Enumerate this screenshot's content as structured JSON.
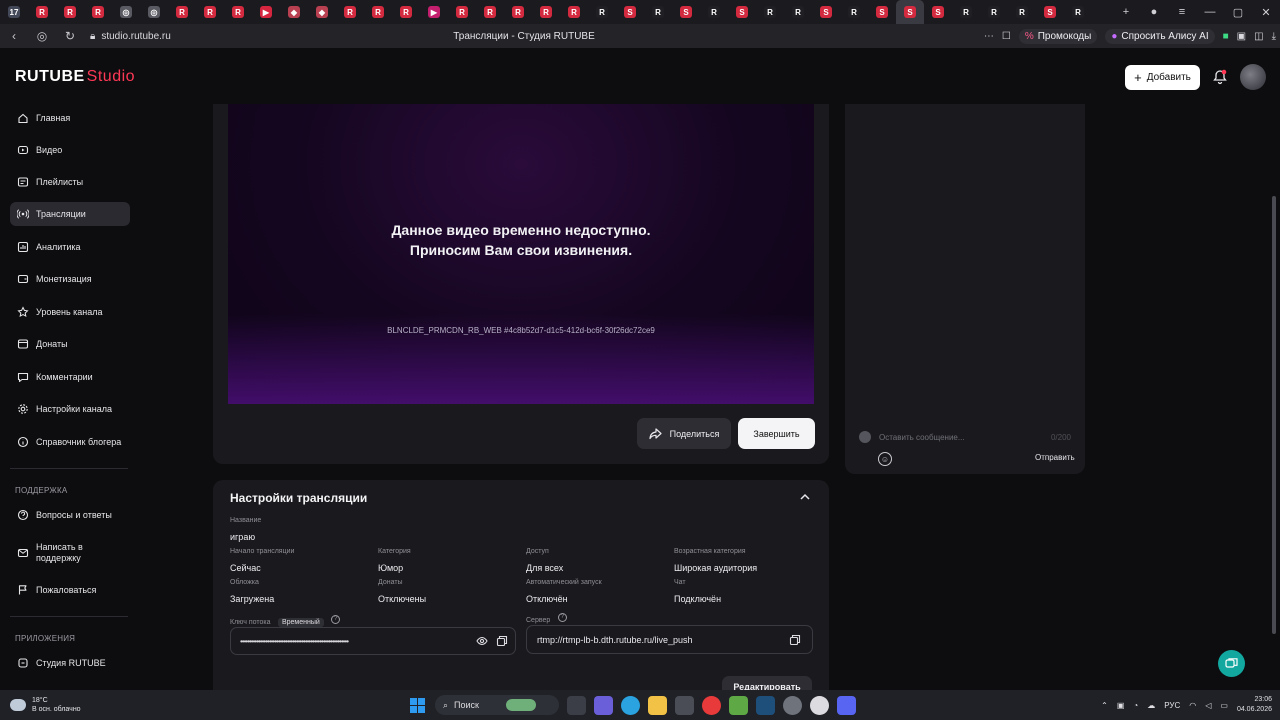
{
  "browser": {
    "tab_icons": [
      {
        "name": "vk-tab",
        "glyph": "17",
        "color": "#44495a"
      },
      {
        "name": "rutube-tab-1",
        "glyph": "R",
        "color": "#d32a3f"
      },
      {
        "name": "rutube-tab-2",
        "glyph": "R",
        "color": "#d32a3f"
      },
      {
        "name": "rutube-tab-3",
        "glyph": "R",
        "color": "#d32a3f"
      },
      {
        "name": "globe-tab",
        "glyph": "◎",
        "color": "#5a5a63"
      },
      {
        "name": "globe-tab-2",
        "glyph": "◎",
        "color": "#5a5a63"
      },
      {
        "name": "rutube-tab-4",
        "glyph": "R",
        "color": "#d32a3f"
      },
      {
        "name": "rutube-tab-5",
        "glyph": "R",
        "color": "#d32a3f"
      },
      {
        "name": "rutube-tab-6",
        "glyph": "R",
        "color": "#d32a3f"
      },
      {
        "name": "play-tab",
        "glyph": "▶",
        "color": "#d6263f"
      },
      {
        "name": "game-tab-1",
        "glyph": "◆",
        "color": "#b84050"
      },
      {
        "name": "game-tab-2",
        "glyph": "◆",
        "color": "#b84050"
      },
      {
        "name": "rutube-tab-7",
        "glyph": "R",
        "color": "#d32a3f"
      },
      {
        "name": "rutube-tab-8",
        "glyph": "R",
        "color": "#d32a3f"
      },
      {
        "name": "rutube-tab-9",
        "glyph": "R",
        "color": "#d32a3f"
      },
      {
        "name": "video-tab",
        "glyph": "▶",
        "color": "#c41e6e"
      },
      {
        "name": "rutube-tab-10",
        "glyph": "R",
        "color": "#d32a3f"
      },
      {
        "name": "rutube-tab-11",
        "glyph": "R",
        "color": "#d32a3f"
      },
      {
        "name": "rutube-tab-12",
        "glyph": "R",
        "color": "#d32a3f"
      },
      {
        "name": "rutube-tab-13",
        "glyph": "R",
        "color": "#d32a3f"
      },
      {
        "name": "rutube-tab-14",
        "glyph": "R",
        "color": "#d32a3f"
      },
      {
        "name": "rutube-tab-15",
        "glyph": "R",
        "color": "#1f1f24"
      },
      {
        "name": "studio-tab-1",
        "glyph": "S",
        "color": "#d32a3f"
      },
      {
        "name": "rutube-tab-16",
        "glyph": "R",
        "color": "#1f1f24"
      },
      {
        "name": "studio-tab-2",
        "glyph": "S",
        "color": "#d32a3f"
      },
      {
        "name": "rutube-tab-17",
        "glyph": "R",
        "color": "#1f1f24"
      },
      {
        "name": "studio-tab-3",
        "glyph": "S",
        "color": "#d32a3f"
      },
      {
        "name": "rutube-tab-18",
        "glyph": "R",
        "color": "#1f1f24"
      },
      {
        "name": "rutube-tab-19",
        "glyph": "R",
        "color": "#1f1f24"
      },
      {
        "name": "studio-tab-4",
        "glyph": "S",
        "color": "#d32a3f"
      },
      {
        "name": "rutube-tab-20",
        "glyph": "R",
        "color": "#1f1f24"
      },
      {
        "name": "studio-tab-5",
        "glyph": "S",
        "color": "#d32a3f"
      },
      {
        "name": "studio-tab-active",
        "glyph": "S",
        "color": "#d32a3f",
        "active": true
      },
      {
        "name": "studio-tab-6",
        "glyph": "S",
        "color": "#d32a3f"
      },
      {
        "name": "rutube-tab-21",
        "glyph": "R",
        "color": "#1f1f24"
      },
      {
        "name": "rutube-tab-22",
        "glyph": "R",
        "color": "#1f1f24"
      },
      {
        "name": "rutube-tab-23",
        "glyph": "R",
        "color": "#1f1f24"
      },
      {
        "name": "studio-tab-7",
        "glyph": "S",
        "color": "#d32a3f"
      },
      {
        "name": "rutube-tab-24",
        "glyph": "R",
        "color": "#1f1f24"
      }
    ],
    "url": "studio.rutube.ru",
    "page_title": "Трансляции - Студия RUTUBE",
    "promo_label": "Промокоды",
    "alice_label": "Спросить Алису AI"
  },
  "header": {
    "logo_main": "RUTUBE",
    "logo_studio": "Studio",
    "add_label": "Добавить",
    "accent": "#ff3856"
  },
  "sidebar": {
    "items": [
      {
        "id": "home",
        "label": "Главная",
        "icon": "home-icon"
      },
      {
        "id": "video",
        "label": "Видео",
        "icon": "video-icon"
      },
      {
        "id": "playlists",
        "label": "Плейлисты",
        "icon": "playlist-icon"
      },
      {
        "id": "streams",
        "label": "Трансляции",
        "icon": "broadcast-icon",
        "active": true
      },
      {
        "id": "analytics",
        "label": "Аналитика",
        "icon": "analytics-icon"
      },
      {
        "id": "monetization",
        "label": "Монетизация",
        "icon": "wallet-icon"
      },
      {
        "id": "channel-level",
        "label": "Уровень канала",
        "icon": "star-icon"
      },
      {
        "id": "donations",
        "label": "Донаты",
        "icon": "donate-icon"
      },
      {
        "id": "comments",
        "label": "Комментарии",
        "icon": "comment-icon"
      },
      {
        "id": "channel-settings",
        "label": "Настройки канала",
        "icon": "gear-icon"
      },
      {
        "id": "blogger-guide",
        "label": "Справочник блогера",
        "icon": "info-icon"
      }
    ],
    "support_title": "ПОДДЕРЖКА",
    "support_items": [
      {
        "id": "faq",
        "label": "Вопросы и ответы",
        "icon": "question-icon"
      },
      {
        "id": "contact",
        "label": "Написать в поддержку",
        "label_line2": "",
        "icon": "mail-icon"
      },
      {
        "id": "complain",
        "label": "Пожаловаться",
        "icon": "flag-icon"
      }
    ],
    "apps_title": "ПРИЛОЖЕНИЯ",
    "apps_items": [
      {
        "id": "studio-app",
        "label": "Студия RUTUBE",
        "icon": "app-icon"
      }
    ]
  },
  "player": {
    "message_line1": "Данное видео временно недоступно.",
    "message_line2": "Приносим Вам свои извинения.",
    "error_code": "BLNCLDE_PRMCDN_RB_WEB #4c8b52d7-d1c5-412d-bc6f-30f26dc72ce9",
    "share_label": "Поделиться",
    "end_label": "Завершить"
  },
  "chat": {
    "placeholder": "Оставить сообщение...",
    "counter": "0/200",
    "send_label": "Отправить"
  },
  "settings": {
    "title": "Настройки трансляции",
    "name_label": "Название",
    "name_value": "играю",
    "start_label": "Начало трансляции",
    "start_value": "Сейчас",
    "category_label": "Категория",
    "category_value": "Юмор",
    "access_label": "Доступ",
    "access_value": "Для всех",
    "age_label": "Возрастная категория",
    "age_value": "Широкая аудитория",
    "cover_label": "Обложка",
    "cover_value": "Загружена",
    "donations_label": "Донаты",
    "donations_value": "Отключены",
    "autostart_label": "Автоматический запуск",
    "autostart_value": "Отключён",
    "chat_label": "Чат",
    "chat_value": "Подключён",
    "key_label": "Ключ потока",
    "key_badge": "Временный",
    "key_masked": "••••••••••••••••••••••••••••••••••••••••••••••••••••••••••••",
    "server_label": "Сервер",
    "server_value": "rtmp://rtmp-lb-b.dth.rutube.ru/live_push",
    "edit_label": "Редактировать"
  },
  "taskbar": {
    "temp": "18°C",
    "weather": "В осн. облачно",
    "search_label": "Поиск",
    "lang": "РУС",
    "time": "23:06",
    "date": "04.06.2026"
  }
}
